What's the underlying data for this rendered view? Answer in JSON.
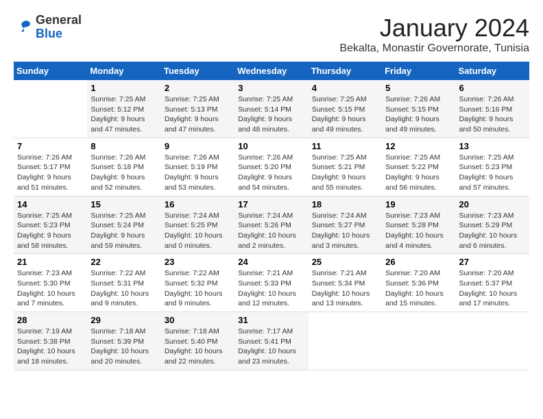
{
  "logo": {
    "general": "General",
    "blue": "Blue"
  },
  "title": "January 2024",
  "location": "Bekalta, Monastir Governorate, Tunisia",
  "days_of_week": [
    "Sunday",
    "Monday",
    "Tuesday",
    "Wednesday",
    "Thursday",
    "Friday",
    "Saturday"
  ],
  "weeks": [
    [
      {
        "day": "",
        "info": ""
      },
      {
        "day": "1",
        "info": "Sunrise: 7:25 AM\nSunset: 5:12 PM\nDaylight: 9 hours\nand 47 minutes."
      },
      {
        "day": "2",
        "info": "Sunrise: 7:25 AM\nSunset: 5:13 PM\nDaylight: 9 hours\nand 47 minutes."
      },
      {
        "day": "3",
        "info": "Sunrise: 7:25 AM\nSunset: 5:14 PM\nDaylight: 9 hours\nand 48 minutes."
      },
      {
        "day": "4",
        "info": "Sunrise: 7:25 AM\nSunset: 5:15 PM\nDaylight: 9 hours\nand 49 minutes."
      },
      {
        "day": "5",
        "info": "Sunrise: 7:26 AM\nSunset: 5:15 PM\nDaylight: 9 hours\nand 49 minutes."
      },
      {
        "day": "6",
        "info": "Sunrise: 7:26 AM\nSunset: 5:16 PM\nDaylight: 9 hours\nand 50 minutes."
      }
    ],
    [
      {
        "day": "7",
        "info": "Sunrise: 7:26 AM\nSunset: 5:17 PM\nDaylight: 9 hours\nand 51 minutes."
      },
      {
        "day": "8",
        "info": "Sunrise: 7:26 AM\nSunset: 5:18 PM\nDaylight: 9 hours\nand 52 minutes."
      },
      {
        "day": "9",
        "info": "Sunrise: 7:26 AM\nSunset: 5:19 PM\nDaylight: 9 hours\nand 53 minutes."
      },
      {
        "day": "10",
        "info": "Sunrise: 7:26 AM\nSunset: 5:20 PM\nDaylight: 9 hours\nand 54 minutes."
      },
      {
        "day": "11",
        "info": "Sunrise: 7:25 AM\nSunset: 5:21 PM\nDaylight: 9 hours\nand 55 minutes."
      },
      {
        "day": "12",
        "info": "Sunrise: 7:25 AM\nSunset: 5:22 PM\nDaylight: 9 hours\nand 56 minutes."
      },
      {
        "day": "13",
        "info": "Sunrise: 7:25 AM\nSunset: 5:23 PM\nDaylight: 9 hours\nand 57 minutes."
      }
    ],
    [
      {
        "day": "14",
        "info": "Sunrise: 7:25 AM\nSunset: 5:23 PM\nDaylight: 9 hours\nand 58 minutes."
      },
      {
        "day": "15",
        "info": "Sunrise: 7:25 AM\nSunset: 5:24 PM\nDaylight: 9 hours\nand 59 minutes."
      },
      {
        "day": "16",
        "info": "Sunrise: 7:24 AM\nSunset: 5:25 PM\nDaylight: 10 hours\nand 0 minutes."
      },
      {
        "day": "17",
        "info": "Sunrise: 7:24 AM\nSunset: 5:26 PM\nDaylight: 10 hours\nand 2 minutes."
      },
      {
        "day": "18",
        "info": "Sunrise: 7:24 AM\nSunset: 5:27 PM\nDaylight: 10 hours\nand 3 minutes."
      },
      {
        "day": "19",
        "info": "Sunrise: 7:23 AM\nSunset: 5:28 PM\nDaylight: 10 hours\nand 4 minutes."
      },
      {
        "day": "20",
        "info": "Sunrise: 7:23 AM\nSunset: 5:29 PM\nDaylight: 10 hours\nand 6 minutes."
      }
    ],
    [
      {
        "day": "21",
        "info": "Sunrise: 7:23 AM\nSunset: 5:30 PM\nDaylight: 10 hours\nand 7 minutes."
      },
      {
        "day": "22",
        "info": "Sunrise: 7:22 AM\nSunset: 5:31 PM\nDaylight: 10 hours\nand 9 minutes."
      },
      {
        "day": "23",
        "info": "Sunrise: 7:22 AM\nSunset: 5:32 PM\nDaylight: 10 hours\nand 9 minutes."
      },
      {
        "day": "24",
        "info": "Sunrise: 7:21 AM\nSunset: 5:33 PM\nDaylight: 10 hours\nand 12 minutes."
      },
      {
        "day": "25",
        "info": "Sunrise: 7:21 AM\nSunset: 5:34 PM\nDaylight: 10 hours\nand 13 minutes."
      },
      {
        "day": "26",
        "info": "Sunrise: 7:20 AM\nSunset: 5:36 PM\nDaylight: 10 hours\nand 15 minutes."
      },
      {
        "day": "27",
        "info": "Sunrise: 7:20 AM\nSunset: 5:37 PM\nDaylight: 10 hours\nand 17 minutes."
      }
    ],
    [
      {
        "day": "28",
        "info": "Sunrise: 7:19 AM\nSunset: 5:38 PM\nDaylight: 10 hours\nand 18 minutes."
      },
      {
        "day": "29",
        "info": "Sunrise: 7:18 AM\nSunset: 5:39 PM\nDaylight: 10 hours\nand 20 minutes."
      },
      {
        "day": "30",
        "info": "Sunrise: 7:18 AM\nSunset: 5:40 PM\nDaylight: 10 hours\nand 22 minutes."
      },
      {
        "day": "31",
        "info": "Sunrise: 7:17 AM\nSunset: 5:41 PM\nDaylight: 10 hours\nand 23 minutes."
      },
      {
        "day": "",
        "info": ""
      },
      {
        "day": "",
        "info": ""
      },
      {
        "day": "",
        "info": ""
      }
    ]
  ]
}
